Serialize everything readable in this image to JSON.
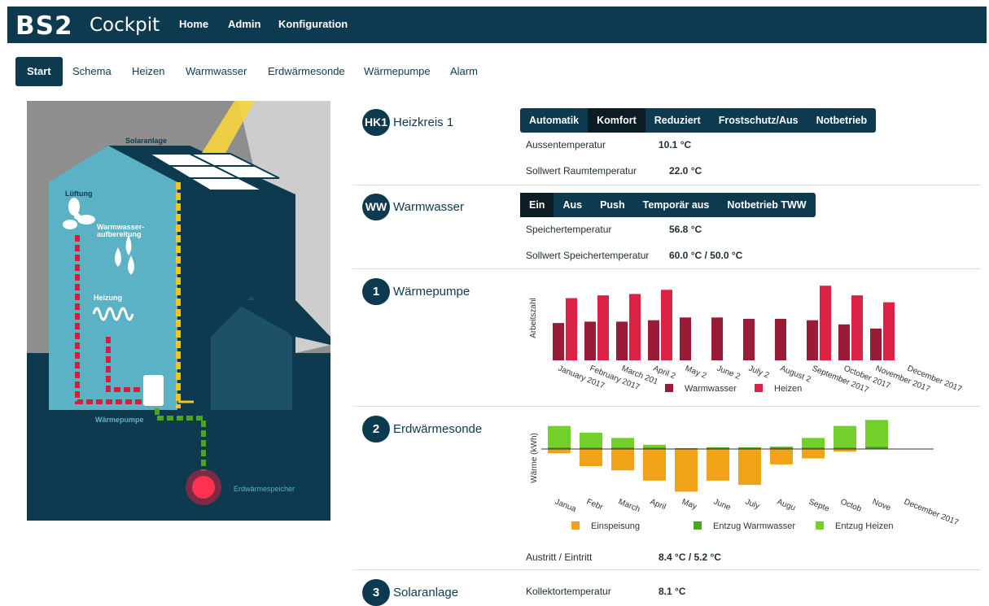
{
  "app": {
    "logo": "BS2",
    "name": "Cockpit"
  },
  "topnav": [
    "Home",
    "Admin",
    "Konfiguration"
  ],
  "tabs": [
    "Start",
    "Schema",
    "Heizen",
    "Warmwasser",
    "Erdwärmesonde",
    "Wärmepumpe",
    "Alarm"
  ],
  "illustration": {
    "labels": {
      "solar": "Solaranlage",
      "lueftung": "Lüftung",
      "ww1": "Warmwasser-",
      "ww2": "aufbereitung",
      "heizung": "Heizung",
      "wp": "Wärmepumpe",
      "speicher": "Erdwärmespeicher"
    }
  },
  "hk1": {
    "badge": "HK1",
    "title": "Heizkreis 1",
    "modes": [
      "Automatik",
      "Komfort",
      "Reduziert",
      "Frostschutz/Aus",
      "Notbetrieb"
    ],
    "selected_mode": "Komfort",
    "rows": [
      {
        "label": "Aussentemperatur",
        "value": "10.1 °C"
      },
      {
        "label": "Sollwert Raumtemperatur",
        "value": "22.0 °C"
      }
    ]
  },
  "ww": {
    "badge": "WW",
    "title": "Warmwasser",
    "modes": [
      "Ein",
      "Aus",
      "Push",
      "Temporär aus",
      "Notbetrieb TWW"
    ],
    "selected_mode": "Ein",
    "rows": [
      {
        "label": "Speichertemperatur",
        "value": "56.8 °C"
      },
      {
        "label": "Sollwert Speichertemperatur",
        "value": "60.0 °C / 50.0 °C"
      }
    ]
  },
  "wp": {
    "badge": "1",
    "title": "Wärmepumpe"
  },
  "ews": {
    "badge": "2",
    "title": "Erdwärmesonde",
    "rows": [
      {
        "label": "Austritt / Eintritt",
        "value": "8.4 °C / 5.2 °C"
      }
    ]
  },
  "solar": {
    "badge": "3",
    "title": "Solaranlage",
    "rows": [
      {
        "label": "Kollektortemperatur",
        "value": "8.1 °C"
      }
    ]
  },
  "chart_data": [
    {
      "type": "bar",
      "ylabel": "Arbeitszahl",
      "categories": [
        "January 2017",
        "February 2017",
        "March 201",
        "April 2",
        "May 2",
        "June 2",
        "July 2",
        "August 2",
        "September 2017",
        "October 2017",
        "November 2017",
        "December 2017"
      ],
      "series": [
        {
          "name": "Warmwasser",
          "color": "#9a1b35",
          "values": [
            2.7,
            2.8,
            2.8,
            2.9,
            3.1,
            3.1,
            3.0,
            3.0,
            2.9,
            2.6,
            2.3,
            null
          ]
        },
        {
          "name": "Heizen",
          "color": "#dd2345",
          "values": [
            4.5,
            4.7,
            4.8,
            5.1,
            null,
            null,
            null,
            null,
            5.4,
            4.7,
            4.2,
            null
          ]
        }
      ],
      "legend": "bottom"
    },
    {
      "type": "bar",
      "ylabel": "Wärme (kWh)",
      "categories": [
        "Janua",
        "Febr",
        "March",
        "April",
        "May",
        "June",
        "July",
        "Augu",
        "Septe",
        "Octob",
        "Nove",
        "December 2017"
      ],
      "series": [
        {
          "name": "Einspeisung",
          "color": "#f0a319",
          "values": [
            -5,
            -20,
            -25,
            -37,
            -50,
            -37,
            -42,
            -18,
            -11,
            -3,
            0,
            null
          ]
        },
        {
          "name": "Entzug Warmwasser",
          "color": "#4aa521",
          "values": [
            2,
            2,
            2,
            2,
            1,
            2,
            2,
            2,
            2,
            2,
            3,
            null
          ]
        },
        {
          "name": "Entzug Heizen",
          "color": "#73cf2a",
          "values": [
            25,
            17,
            11,
            3,
            0,
            0,
            0,
            1,
            11,
            25,
            31,
            null
          ]
        }
      ],
      "legend": "bottom"
    }
  ]
}
